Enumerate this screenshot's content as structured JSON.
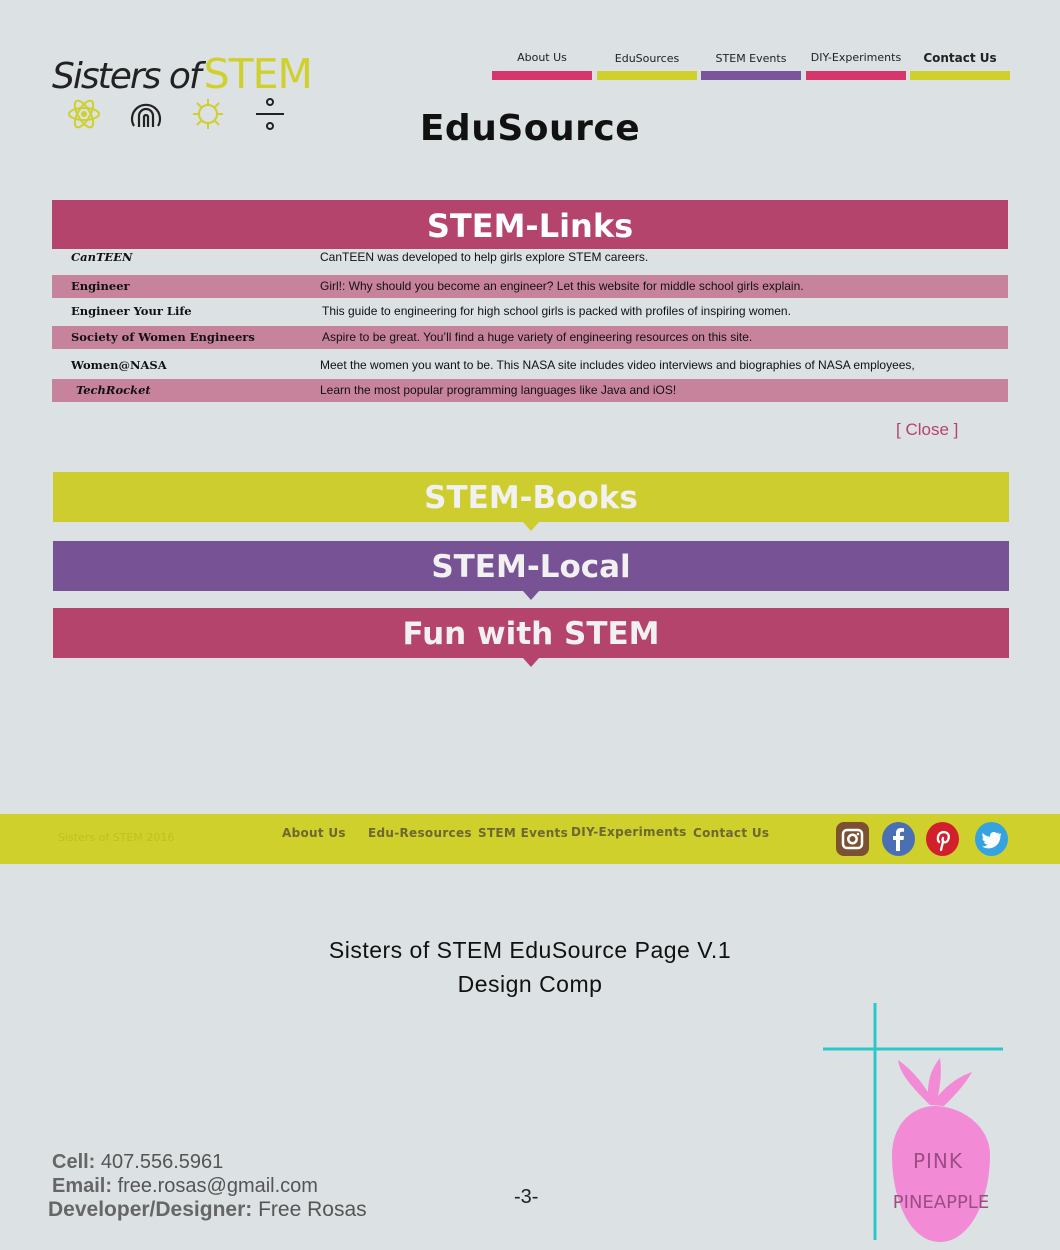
{
  "logo": {
    "part1": "Sisters of",
    "part2": "STEM",
    "icons": [
      "atom-icon",
      "fingerprint-icon",
      "gear-icon",
      "divide-icon"
    ]
  },
  "nav": {
    "items": [
      {
        "label": "About Us",
        "color": "#d6366b"
      },
      {
        "label": "EduSources",
        "color": "#cfd02c"
      },
      {
        "label": "STEM Events",
        "color": "#7a559a"
      },
      {
        "label": "DIY-Experiments",
        "color": "#d6366b"
      },
      {
        "label": "Contact Us",
        "color": "#cfd02c"
      }
    ]
  },
  "page_title": "EduSource",
  "links_section": {
    "title": "STEM-Links",
    "rows": [
      {
        "name": "CanTEEN",
        "desc": "CanTEEN was developed to help girls explore STEM careers."
      },
      {
        "name": "Engineer",
        "desc": "Girl!: Why should you become an engineer? Let this website for middle school girls explain."
      },
      {
        "name": "Engineer Your Life",
        "desc": "This guide to engineering for high school girls is packed with profiles of inspiring women."
      },
      {
        "name": "Society of Women Engineers",
        "desc": "Aspire to be great. You’ll find a huge variety of engineering resources on this site."
      },
      {
        "name": "Women@NASA",
        "desc": "Meet the women you want to be. This NASA site includes video interviews and biographies of NASA employees,"
      },
      {
        "name": "TechRocket",
        "desc": "Learn the most popular programming languages like Java and iOS!"
      }
    ],
    "close_label": "[ Close ]"
  },
  "sections": [
    {
      "title": "STEM-Books",
      "color": "#cdcd30"
    },
    {
      "title": "STEM-Local",
      "color": "#775396"
    },
    {
      "title": "Fun with STEM",
      "color": "#b5446c"
    }
  ],
  "footer": {
    "faint_text": "Sisters of STEM 2016",
    "links": [
      "About Us",
      "Edu-Resources",
      "STEM Events",
      "DIY-Experiments",
      "Contact Us"
    ],
    "social": [
      "instagram-icon",
      "facebook-icon",
      "pinterest-icon",
      "twitter-icon"
    ]
  },
  "caption": {
    "line1": "Sisters of STEM EduSource Page V.1",
    "line2": "Design Comp"
  },
  "contact": {
    "cell_label": "Cell:",
    "cell": "407.556.5961",
    "email_label": "Email:",
    "email": "free.rosas@gmail.com",
    "dev_label": "Developer/Designer:",
    "dev": "Free Rosas"
  },
  "page_number": "-3-",
  "pineapple": {
    "line1": "PINK",
    "line2": "PINEAPPLE"
  }
}
